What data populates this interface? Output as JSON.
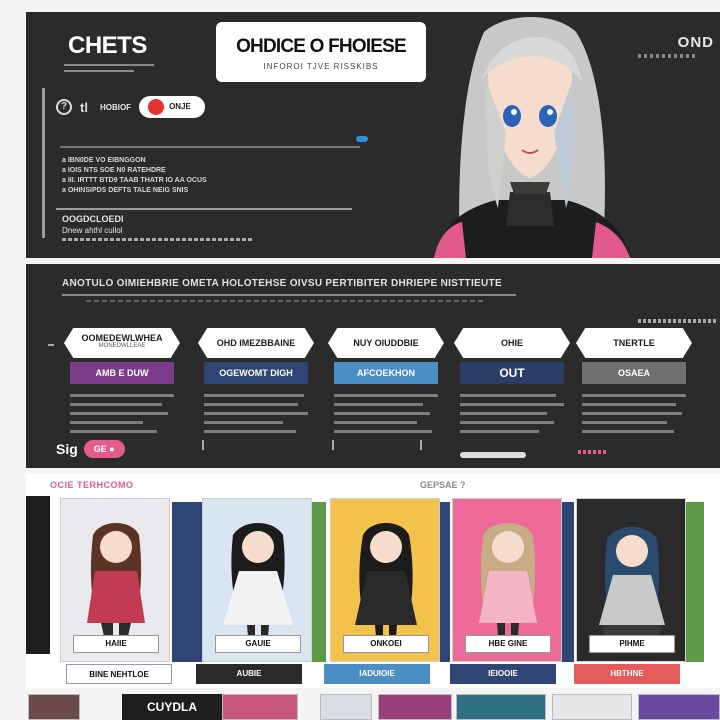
{
  "hero": {
    "title": "CHETS",
    "badge_title": "OHDICE O FHOIESE",
    "badge_sub": "INFOROI TJVE RISSKIBS",
    "corner_text": "OND",
    "help_icon": "?",
    "control_glyph": "tl",
    "control_label": "HOBIOF",
    "toggle_label": "ONJE",
    "lines": [
      "a IBN0DE VO EIBNGGON",
      "a IOIS NTS SOE N0 RATEHDRE",
      "a III. IRTTT BTD9 TAAB THATR IO AA OCUS",
      "a OHINSIPDS DEFTS TALE NEIG SNIS"
    ],
    "note_title": "OOGDCLOEDI",
    "note_sub": "Dnew ahthl cullol"
  },
  "options": {
    "header": "ANOTULO OIMIEHBRIE OMETA HOLOTEHSE OIVSU PERTIBITER DHRIEPE NISTTIEUTE",
    "cards": [
      {
        "tab": "OOMEDEWLWHEA",
        "tab_sub": "MONEDWLLEAE",
        "chip": "AMB E DUW",
        "chip_color": "#7a3c89"
      },
      {
        "tab": "OHD IMEZBBAINE",
        "tab_sub": "",
        "chip": "OGEWOMT DIGH",
        "chip_color": "#2f4573"
      },
      {
        "tab": "NUY OIUDDBIE",
        "tab_sub": "",
        "chip": "AFCOEKHON",
        "chip_color": "#4b8ec4"
      },
      {
        "tab": "OHIE",
        "tab_sub": "",
        "chip": "OUT",
        "chip_color": "#2b3f66"
      },
      {
        "tab": "TNERTLE",
        "tab_sub": "",
        "chip": "OSAEA",
        "chip_color": "#707070"
      }
    ],
    "bottom_label": "Sig",
    "bottom_pill": "GE ●"
  },
  "characters": {
    "title": "OCIE TERHCOMO",
    "title2": "GEPSAE ?",
    "tiles": [
      {
        "name": "HAIIE",
        "plate": "BINE NEHTLOE",
        "bg": "#e9e9ee",
        "band": "#2f4573",
        "plate_bg": "#ffffff",
        "plate_fg": "#111111",
        "hair": "#5b3426",
        "outfit": "#c23b52"
      },
      {
        "name": "GAUIE",
        "plate": "AUBIE",
        "bg": "#d9e6f2",
        "band": "#5c9a4a",
        "plate_bg": "#2a2a2a",
        "plate_fg": "#ffffff",
        "hair": "#1c1c1c",
        "outfit": "#f2f2f2"
      },
      {
        "name": "ONKOEI",
        "plate": "IADUIOIE",
        "bg": "#f3c24b",
        "band": "#2f4573",
        "plate_bg": "#4b8ec4",
        "plate_fg": "#ffffff",
        "hair": "#1c1c1c",
        "outfit": "#2a2a2a"
      },
      {
        "name": "HBE GINE",
        "plate": "IEIOOIE",
        "bg": "#ee6a98",
        "band": "#2f4573",
        "plate_bg": "#2f4573",
        "plate_fg": "#ffffff",
        "hair": "#c7ac86",
        "outfit": "#f6b5c7"
      },
      {
        "name": "PIHME",
        "plate": "HBTHNE",
        "bg": "#2a2a2a",
        "band": "#5c9a4a",
        "plate_bg": "#e45b5b",
        "plate_fg": "#ffffff",
        "hair": "#2a4b6e",
        "outfit": "#c9c9c9"
      }
    ]
  },
  "thumbs": {
    "label": "CUYDLA"
  }
}
